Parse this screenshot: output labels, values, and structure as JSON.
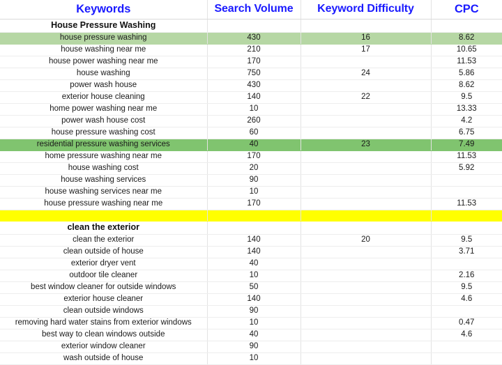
{
  "table": {
    "columns": [
      {
        "id": "keyword",
        "label": "Keywords"
      },
      {
        "id": "volume",
        "label": "Search Volume"
      },
      {
        "id": "difficulty",
        "label": "Keyword Difficulty"
      },
      {
        "id": "cpc",
        "label": "CPC"
      }
    ],
    "header_color": "#1a1aff",
    "highlight_colors": {
      "green_light": "#b6d7a4",
      "green": "#80c46f",
      "yellow": "#ffff00"
    },
    "rows": [
      {
        "type": "section",
        "highlight": "none",
        "keyword": "House Pressure Washing",
        "volume": "",
        "difficulty": "",
        "cpc": ""
      },
      {
        "type": "data",
        "highlight": "green_light",
        "keyword": "house pressure washing",
        "volume": "430",
        "difficulty": "16",
        "cpc": "8.62"
      },
      {
        "type": "data",
        "highlight": "none",
        "keyword": "house washing near me",
        "volume": "210",
        "difficulty": "17",
        "cpc": "10.65"
      },
      {
        "type": "data",
        "highlight": "none",
        "keyword": "house power washing near me",
        "volume": "170",
        "difficulty": "",
        "cpc": "11.53"
      },
      {
        "type": "data",
        "highlight": "none",
        "keyword": "house washing",
        "volume": "750",
        "difficulty": "24",
        "cpc": "5.86"
      },
      {
        "type": "data",
        "highlight": "none",
        "keyword": "power wash house",
        "volume": "430",
        "difficulty": "",
        "cpc": "8.62"
      },
      {
        "type": "data",
        "highlight": "none",
        "keyword": "exterior house cleaning",
        "volume": "140",
        "difficulty": "22",
        "cpc": "9.5"
      },
      {
        "type": "data",
        "highlight": "none",
        "keyword": "home power washing near me",
        "volume": "10",
        "difficulty": "",
        "cpc": "13.33"
      },
      {
        "type": "data",
        "highlight": "none",
        "keyword": "power wash house cost",
        "volume": "260",
        "difficulty": "",
        "cpc": "4.2"
      },
      {
        "type": "data",
        "highlight": "none",
        "keyword": "house pressure washing cost",
        "volume": "60",
        "difficulty": "",
        "cpc": "6.75"
      },
      {
        "type": "data",
        "highlight": "green",
        "keyword": "residential pressure washing services",
        "volume": "40",
        "difficulty": "23",
        "cpc": "7.49"
      },
      {
        "type": "data",
        "highlight": "none",
        "keyword": "home pressure washing near me",
        "volume": "170",
        "difficulty": "",
        "cpc": "11.53"
      },
      {
        "type": "data",
        "highlight": "none",
        "keyword": "house washing cost",
        "volume": "20",
        "difficulty": "",
        "cpc": "5.92"
      },
      {
        "type": "data",
        "highlight": "none",
        "keyword": "house washing services",
        "volume": "90",
        "difficulty": "",
        "cpc": ""
      },
      {
        "type": "data",
        "highlight": "none",
        "keyword": "house washing services near me",
        "volume": "10",
        "difficulty": "",
        "cpc": ""
      },
      {
        "type": "data",
        "highlight": "none",
        "keyword": "house pressure washing near me",
        "volume": "170",
        "difficulty": "",
        "cpc": "11.53"
      },
      {
        "type": "spacer",
        "highlight": "yellow",
        "keyword": "",
        "volume": "",
        "difficulty": "",
        "cpc": ""
      },
      {
        "type": "section",
        "highlight": "none",
        "keyword": "clean the exterior",
        "volume": "",
        "difficulty": "",
        "cpc": ""
      },
      {
        "type": "data",
        "highlight": "none",
        "keyword": "clean the exterior",
        "volume": "140",
        "difficulty": "20",
        "cpc": "9.5"
      },
      {
        "type": "data",
        "highlight": "none",
        "keyword": "clean outside of house",
        "volume": "140",
        "difficulty": "",
        "cpc": "3.71"
      },
      {
        "type": "data",
        "highlight": "none",
        "keyword": "exterior dryer vent",
        "volume": "40",
        "difficulty": "",
        "cpc": ""
      },
      {
        "type": "data",
        "highlight": "none",
        "keyword": "outdoor tile cleaner",
        "volume": "10",
        "difficulty": "",
        "cpc": "2.16"
      },
      {
        "type": "data",
        "highlight": "none",
        "keyword": "best window cleaner for outside windows",
        "volume": "50",
        "difficulty": "",
        "cpc": "9.5"
      },
      {
        "type": "data",
        "highlight": "none",
        "keyword": "exterior house cleaner",
        "volume": "140",
        "difficulty": "",
        "cpc": "4.6"
      },
      {
        "type": "data",
        "highlight": "none",
        "keyword": "clean outside windows",
        "volume": "90",
        "difficulty": "",
        "cpc": ""
      },
      {
        "type": "data",
        "highlight": "none",
        "keyword": "removing hard water stains from exterior windows",
        "volume": "10",
        "difficulty": "",
        "cpc": "0.47"
      },
      {
        "type": "data",
        "highlight": "none",
        "keyword": "best way to clean windows outside",
        "volume": "40",
        "difficulty": "",
        "cpc": "4.6"
      },
      {
        "type": "data",
        "highlight": "none",
        "keyword": "exterior window cleaner",
        "volume": "90",
        "difficulty": "",
        "cpc": ""
      },
      {
        "type": "data",
        "highlight": "none",
        "keyword": "wash outside of house",
        "volume": "10",
        "difficulty": "",
        "cpc": ""
      }
    ]
  }
}
